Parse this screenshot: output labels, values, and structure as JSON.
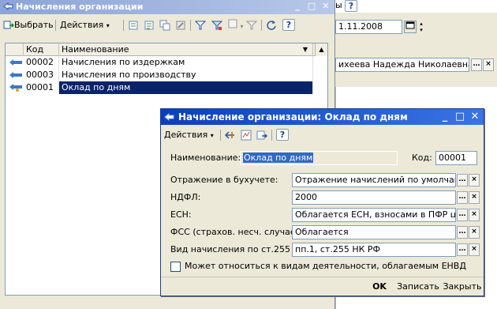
{
  "background": {
    "title_fragment": "ы",
    "date_value": "1.11.2008",
    "employee_value": "ихеева Надежда Николаевна"
  },
  "list_window": {
    "title": "Начисления организации",
    "toolbar": {
      "select_label": "Выбрать",
      "actions_label": "Действия"
    },
    "columns": {
      "code": "Код",
      "name": "Наименование"
    },
    "rows": [
      {
        "code": "00002",
        "name": "Начисления по издержкам",
        "selected": false
      },
      {
        "code": "00003",
        "name": "Начисления по производству",
        "selected": false
      },
      {
        "code": "00001",
        "name": "Оклад по дням",
        "selected": true
      }
    ]
  },
  "dialog": {
    "title": "Начисление организации: Оклад по дням",
    "toolbar": {
      "actions_label": "Действия"
    },
    "name_label": "Наименование:",
    "name_value": "Оклад по дням",
    "code_label": "Код:",
    "code_value": "00001",
    "fields": [
      {
        "label": "Отражение в бухучете:",
        "value": "Отражение начислений по умолчанию"
      },
      {
        "label": "НДФЛ:",
        "value": "2000"
      },
      {
        "label": "ЕСН:",
        "value": "Облагается ЕСН, взносами в ПФР цель"
      },
      {
        "label": "ФСС (страхов. несч. случаев):",
        "value": "Облагается"
      },
      {
        "label": "Вид начисления по ст.255 НК:",
        "value": "пп.1, ст.255 НК РФ"
      }
    ],
    "checkbox_label": "Может относиться к видам деятельности, облагаемым ЕНВД",
    "checkbox_checked": false,
    "buttons": {
      "ok": "OK",
      "save": "Записать",
      "close": "Закрыть"
    }
  },
  "colors": {
    "window_bg": "#ece9d8",
    "active_title": "#0a3fba",
    "inactive_title": "#8ca4d6",
    "selection": "#0a246a"
  }
}
